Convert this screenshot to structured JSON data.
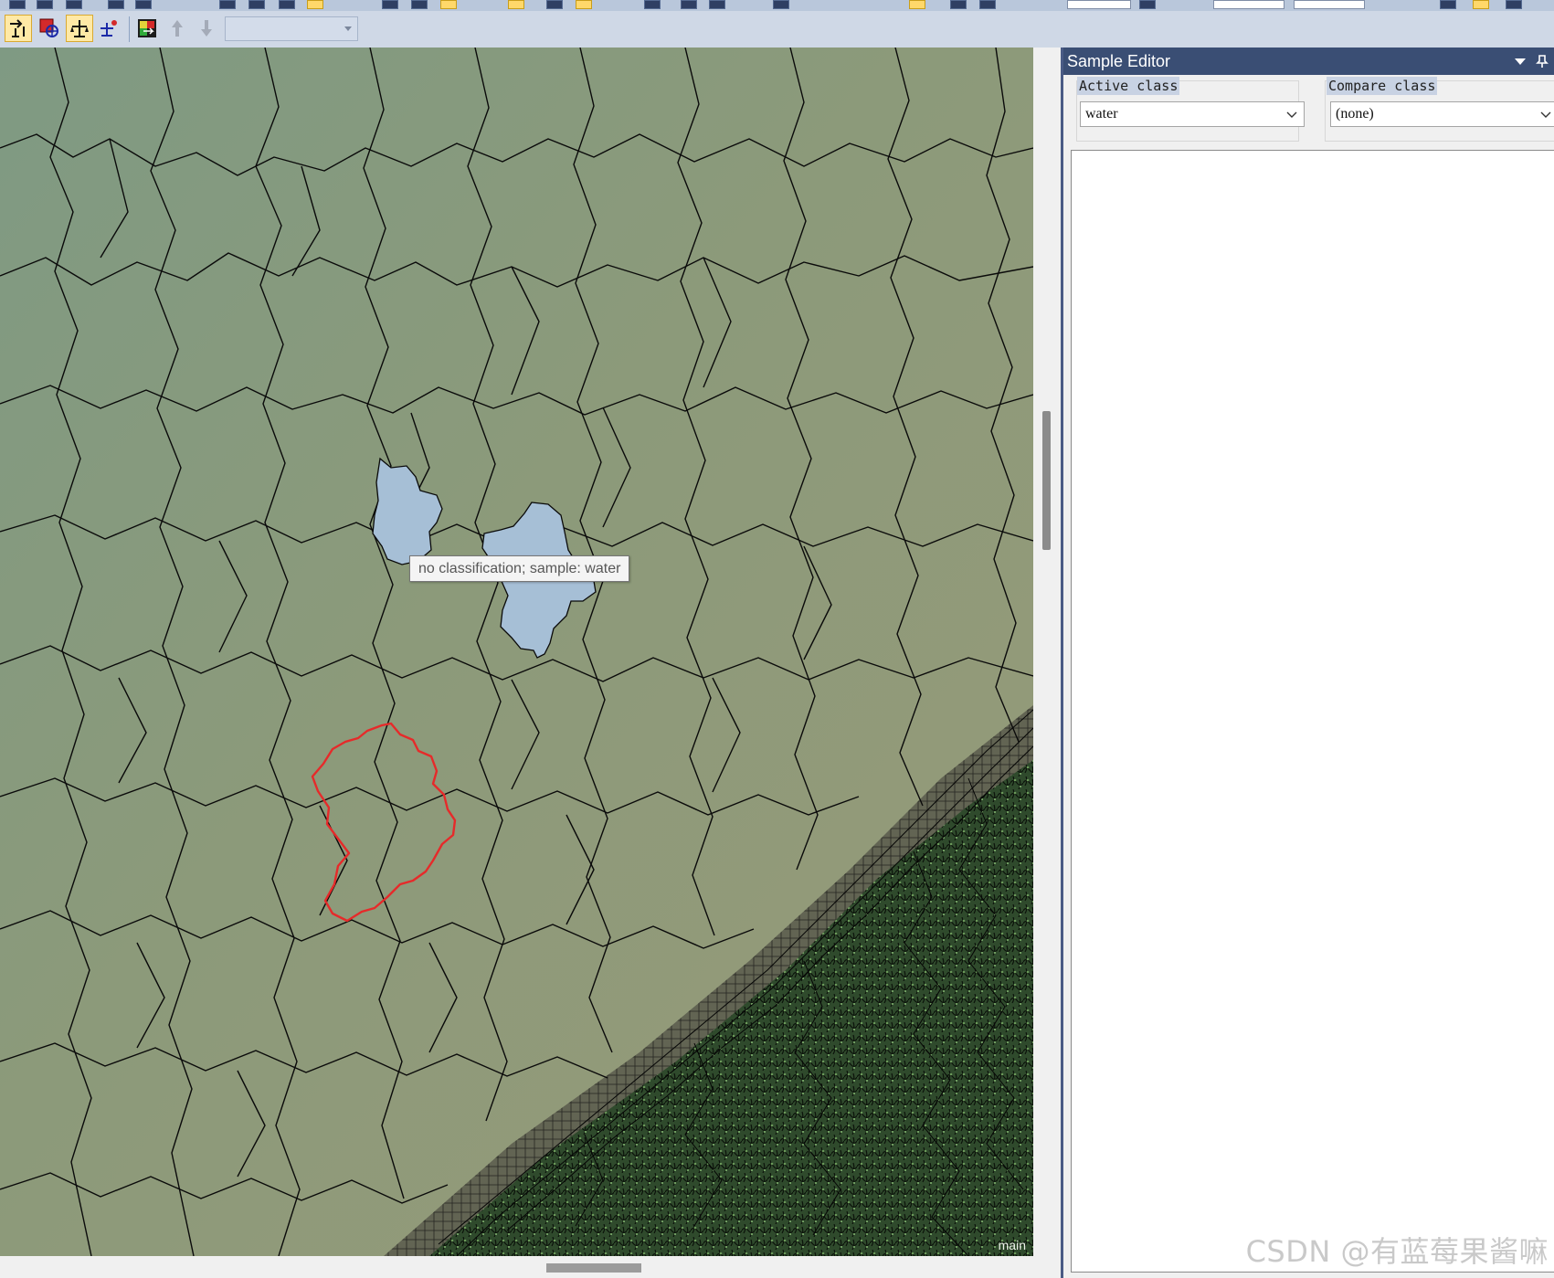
{
  "toolbar": {
    "tools": [
      {
        "name": "sample-editor-tool-icon",
        "active": true
      },
      {
        "name": "select-samples-icon",
        "active": false
      },
      {
        "name": "sample-navigation-icon",
        "active": true
      },
      {
        "name": "sample-selection-info-icon",
        "active": false
      },
      {
        "name": "feature-space-icon",
        "active": false
      },
      {
        "name": "arrow-up-icon",
        "active": false
      },
      {
        "name": "arrow-down-icon",
        "active": false
      }
    ],
    "combo_value": ""
  },
  "map": {
    "tooltip": "no classification;  sample: water",
    "label": "main",
    "colors": {
      "water_sample": "#a6bfd6",
      "selected_outline": "#e62a2a",
      "segment_outline": "#000000"
    }
  },
  "sample_editor": {
    "title": "Sample Editor",
    "active_class_label": "Active class",
    "active_class_value": "water",
    "compare_class_label": "Compare class",
    "compare_class_value": "(none)"
  },
  "watermark": "CSDN @有蓝莓果酱嘛"
}
